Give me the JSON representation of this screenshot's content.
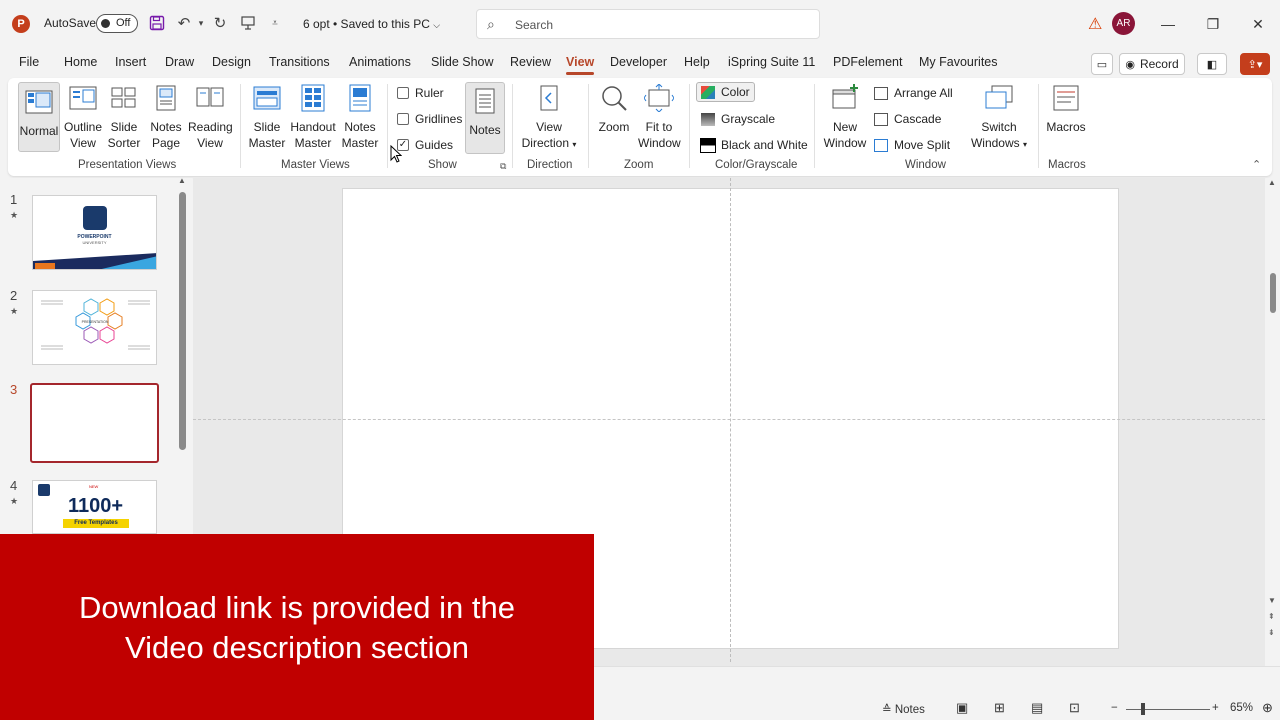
{
  "titlebar": {
    "logo": "P",
    "autosave_label": "AutoSave",
    "autosave_state": "Off",
    "doc_title": "6 opt • Saved to this PC",
    "search_placeholder": "Search",
    "avatar_initials": "AR"
  },
  "tabs": [
    "File",
    "Home",
    "Insert",
    "Draw",
    "Design",
    "Transitions",
    "Animations",
    "Slide Show",
    "Review",
    "View",
    "Developer",
    "Help",
    "iSpring Suite 11",
    "PDFelement",
    "My Favourites"
  ],
  "active_tab": "View",
  "record_label": "Record",
  "ribbon": {
    "presentation_views": {
      "label": "Presentation Views",
      "normal": "Normal",
      "outline_1": "Outline",
      "outline_2": "View",
      "sorter_1": "Slide",
      "sorter_2": "Sorter",
      "notes_1": "Notes",
      "notes_2": "Page",
      "reading_1": "Reading",
      "reading_2": "View"
    },
    "master_views": {
      "label": "Master Views",
      "slide_1": "Slide",
      "slide_2": "Master",
      "handout_1": "Handout",
      "handout_2": "Master",
      "notes_1": "Notes",
      "notes_2": "Master"
    },
    "show": {
      "label": "Show",
      "ruler": "Ruler",
      "gridlines": "Gridlines",
      "guides": "Guides",
      "notes": "Notes"
    },
    "direction": {
      "label": "Direction",
      "btn_1": "View",
      "btn_2": "Direction"
    },
    "zoom": {
      "label": "Zoom",
      "zoom": "Zoom",
      "fit_1": "Fit to",
      "fit_2": "Window"
    },
    "color": {
      "label": "Color/Grayscale",
      "color": "Color",
      "grayscale": "Grayscale",
      "bw": "Black and White"
    },
    "window": {
      "label": "Window",
      "new_1": "New",
      "new_2": "Window",
      "arrange": "Arrange All",
      "cascade": "Cascade",
      "split": "Move Split",
      "switch_1": "Switch",
      "switch_2": "Windows"
    },
    "macros": {
      "label": "Macros",
      "btn": "Macros"
    }
  },
  "slides": [
    {
      "num": "1",
      "star": "★"
    },
    {
      "num": "2",
      "star": "★"
    },
    {
      "num": "3",
      "star": ""
    },
    {
      "num": "4",
      "star": "★"
    }
  ],
  "thumb1": {
    "title": "POWERPOINT",
    "subtitle": "UNIVERSITY"
  },
  "thumb2": {
    "center": "PRESENTATION"
  },
  "thumb4": {
    "big": "1100+",
    "tag": "Free Templates",
    "top": "NEW"
  },
  "banner": {
    "line1": "Download link is provided in the",
    "line2": "Video description section"
  },
  "status": {
    "notes": "Notes",
    "zoom": "65%"
  },
  "colors": {
    "accent": "#b7472a",
    "banner": "#c00000",
    "selected_slide": "#a4262c"
  }
}
